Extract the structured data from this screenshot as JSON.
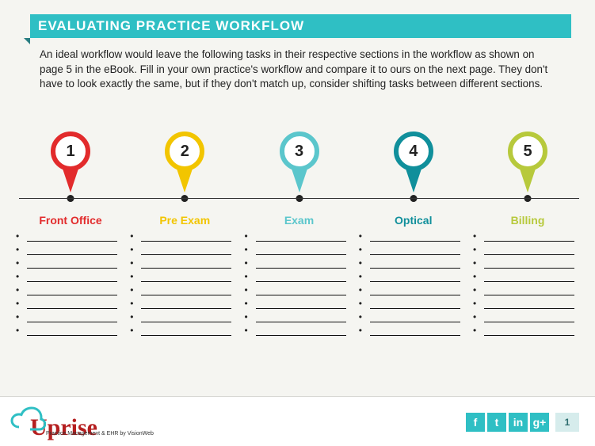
{
  "header": {
    "title": "EVALUATING PRACTICE WORKFLOW"
  },
  "intro": "An ideal workflow would leave the following tasks in their respective sections in the workflow as shown on page 5 in the eBook. Fill in your own practice's workflow and compare it to ours on the next page. They don't have to look exactly the same, but if they don't match up, consider shifting tasks between different sections.",
  "stages": [
    {
      "num": "1",
      "label": "Front Office",
      "color": "#e22b2c",
      "blanks": 8
    },
    {
      "num": "2",
      "label": "Pre Exam",
      "color": "#f2c500",
      "blanks": 8
    },
    {
      "num": "3",
      "label": "Exam",
      "color": "#5bc6cc",
      "blanks": 8
    },
    {
      "num": "4",
      "label": "Optical",
      "color": "#108f9b",
      "blanks": 8
    },
    {
      "num": "5",
      "label": "Billing",
      "color": "#b7c93c",
      "blanks": 8
    }
  ],
  "logo": {
    "name": "Uprise",
    "tagline": "Practice Management & EHR by VisionWeb"
  },
  "social_icons": [
    {
      "name": "facebook-icon",
      "glyph": "f"
    },
    {
      "name": "twitter-icon",
      "glyph": "t"
    },
    {
      "name": "linkedin-icon",
      "glyph": "in"
    },
    {
      "name": "googleplus-icon",
      "glyph": "g+"
    }
  ],
  "page_number": "1"
}
